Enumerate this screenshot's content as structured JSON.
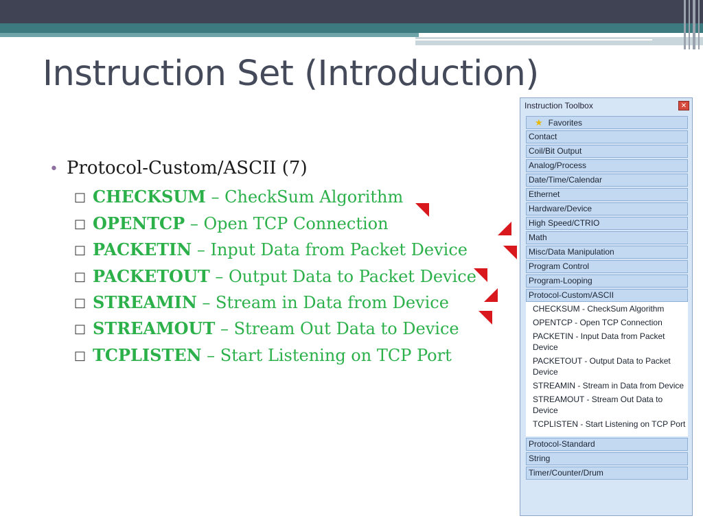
{
  "slide": {
    "title": "Instruction Set (Introduction)",
    "bullet": "Protocol-Custom/ASCII (7)",
    "sub_items": [
      {
        "code": "CHECKSUM",
        "desc": " – CheckSum Algorithm"
      },
      {
        "code": "OPENTCP",
        "desc": " – Open TCP Connection"
      },
      {
        "code": "PACKETIN",
        "desc": " – Input Data from Packet Device"
      },
      {
        "code": "PACKETOUT",
        "desc": " – Output Data to Packet Device"
      },
      {
        "code": "STREAMIN",
        "desc": " – Stream in Data from Device"
      },
      {
        "code": "STREAMOUT",
        "desc": " – Stream Out Data to Device"
      },
      {
        "code": "TCPLISTEN",
        "desc": " – Start Listening on TCP Port"
      }
    ]
  },
  "toolbox": {
    "title": "Instruction Toolbox",
    "close_icon": "close-icon",
    "favorites": "Favorites",
    "categories_top": [
      "Contact",
      "Coil/Bit Output",
      "Analog/Process",
      "Date/Time/Calendar",
      "Ethernet",
      "Hardware/Device",
      "High Speed/CTRIO",
      "Math",
      "Misc/Data Manipulation",
      "Program Control",
      "Program-Looping",
      "Protocol-Custom/ASCII"
    ],
    "expanded": [
      "CHECKSUM - CheckSum Algorithm",
      "OPENTCP - Open TCP Connection",
      "PACKETIN - Input Data from Packet Device",
      "PACKETOUT - Output Data to Packet Device",
      "STREAMIN - Stream in Data from Device",
      "STREAMOUT - Stream Out Data to Device",
      "TCPLISTEN - Start Listening on TCP Port"
    ],
    "categories_bottom": [
      "Protocol-Standard",
      "String",
      "Timer/Counter/Drum"
    ]
  },
  "colors": {
    "code_green": "#2bb04a",
    "arrow_red": "#d9181e",
    "header_dark": "#3f4354",
    "header_teal": "#3d7a80"
  }
}
